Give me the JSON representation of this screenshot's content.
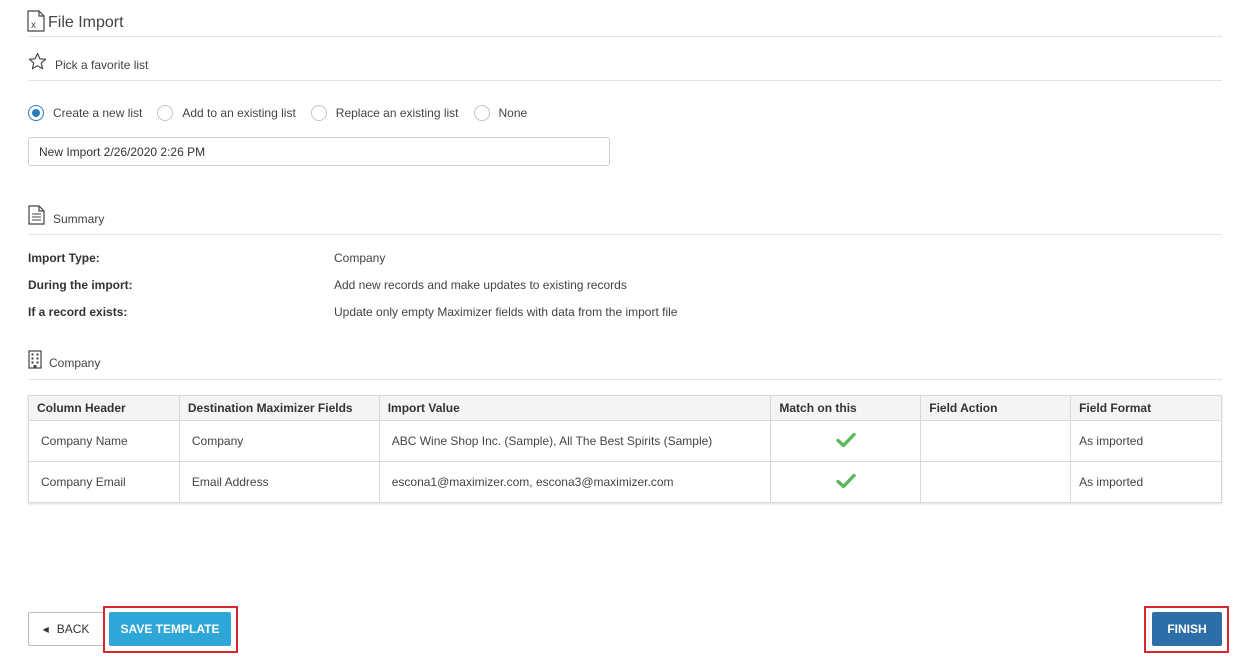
{
  "header": {
    "title": "File Import",
    "icon": "excel-file-icon"
  },
  "favorite": {
    "title": "Pick a favorite list",
    "icon": "star-icon"
  },
  "list_options": {
    "selected": "Create a new list",
    "options": [
      "Create a new list",
      "Add to an existing list",
      "Replace an existing list",
      "None"
    ]
  },
  "list_name": {
    "value": "New Import 2/26/2020 2:26 PM"
  },
  "summary": {
    "title": "Summary",
    "icon": "document-icon",
    "rows": [
      {
        "label": "Import Type:",
        "value": "Company"
      },
      {
        "label": "During the import:",
        "value": "Add new records and make updates to existing records"
      },
      {
        "label": "If a record exists:",
        "value": "Update only empty Maximizer fields with data from the import file"
      }
    ]
  },
  "company": {
    "title": "Company",
    "icon": "building-icon",
    "columns": [
      "Column Header",
      "Destination Maximizer Fields",
      "Import Value",
      "Match on this",
      "Field Action",
      "Field Format"
    ],
    "rows": [
      {
        "column_header": "Company Name",
        "destination": "Company",
        "import_value": "ABC Wine Shop Inc. (Sample), All The Best Spirits (Sample)",
        "match": true,
        "field_action": "",
        "field_format": "As imported"
      },
      {
        "column_header": "Company Email",
        "destination": "Email Address",
        "import_value": "escona1@maximizer.com, escona3@maximizer.com",
        "match": true,
        "field_action": "",
        "field_format": "As imported"
      }
    ]
  },
  "buttons": {
    "back": "BACK",
    "save_template": "SAVE TEMPLATE",
    "finish": "FINISH"
  },
  "colors": {
    "accent": "#2b7bc0",
    "save_button": "#2ea7d8",
    "finish_button": "#2d6da8",
    "check": "#5cb85c",
    "highlight": "#d9262e"
  }
}
